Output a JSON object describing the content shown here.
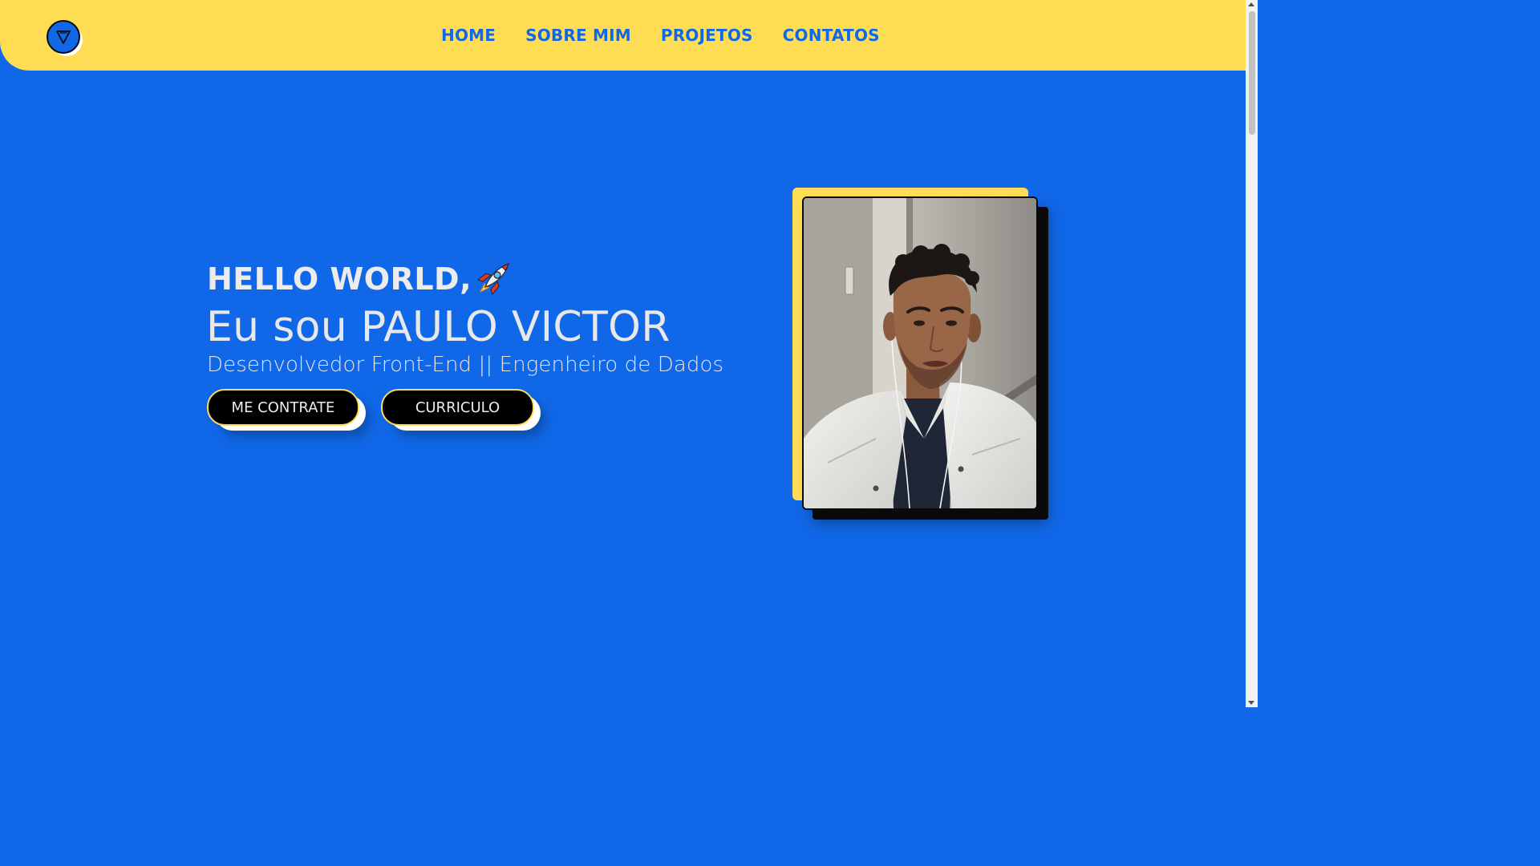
{
  "brand": {
    "logo_glyph": "∇",
    "logo_icon": "nabla-logo-icon"
  },
  "nav": {
    "items": [
      {
        "label": "HOME"
      },
      {
        "label": "SOBRE MIM"
      },
      {
        "label": "PROJETOS"
      },
      {
        "label": "CONTATOS"
      }
    ]
  },
  "hero": {
    "greeting": "HELLO WORLD,",
    "greeting_icon": "rocket-icon",
    "name_line": "Eu sou PAULO VICTOR",
    "role": "Desenvolvedor Front-End || Engenheiro de Dados",
    "buttons": {
      "hire": "ME CONTRATE",
      "resume": "CURRICULO"
    },
    "photo_icon": "profile-photo"
  },
  "colors": {
    "background": "#1068e8",
    "header": "#fedd55",
    "button_bg": "#000000",
    "text_light": "#ececec"
  }
}
